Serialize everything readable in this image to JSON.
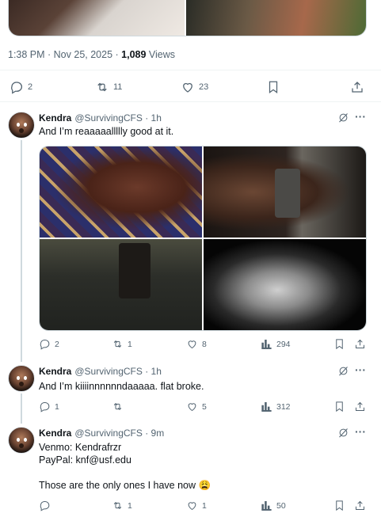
{
  "main_post": {
    "time": "1:38 PM · Nov 25, 2025 · ",
    "views_count": "1,089",
    "views_label": " Views",
    "replies": "2",
    "reposts": "11",
    "likes": "23"
  },
  "replies": [
    {
      "name": "Kendra",
      "handle": "@SurvivingCFS · 1h",
      "text": "And I’m reaaaaallllly good at it.",
      "replies": "2",
      "reposts": "1",
      "likes": "8",
      "views": "294"
    },
    {
      "name": "Kendra",
      "handle": "@SurvivingCFS · 1h",
      "text": "And I’m kiiiinnnnnndaaaaa. flat broke.",
      "replies": "1",
      "reposts": "",
      "likes": "5",
      "views": "312"
    },
    {
      "name": "Kendra",
      "handle": "@SurvivingCFS · 9m",
      "text_lines": [
        "Venmo: Kendrafrzr",
        "PayPal: knf@usf.edu",
        "",
        "Those are the only ones I have now 😩"
      ],
      "replies": "",
      "reposts": "1",
      "likes": "1",
      "views": "50"
    }
  ],
  "icons": {
    "reply": "reply-icon",
    "repost": "repost-icon",
    "like": "heart-icon",
    "bookmark": "bookmark-icon",
    "share": "share-icon",
    "views": "views-icon",
    "grok": "grok-icon",
    "more": "more-icon"
  },
  "colors": {
    "text": "#0f1419",
    "secondary": "#536471",
    "border": "#cfd9de",
    "divider": "#eff3f4"
  }
}
